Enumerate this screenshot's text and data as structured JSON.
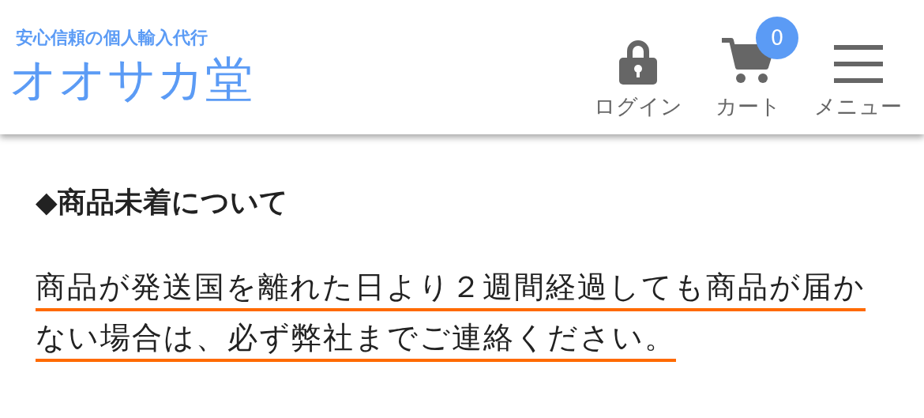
{
  "header": {
    "tagline": "安心信頼の個人輸入代行",
    "logo": "オオサカ堂",
    "nav": [
      {
        "kind": "lock",
        "label": "ログイン"
      },
      {
        "kind": "cart",
        "label": "カート",
        "badge": "0"
      },
      {
        "kind": "menu",
        "label": "メニュー"
      }
    ]
  },
  "section": {
    "heading": "◆商品未着について",
    "body": "商品が発送国を離れた日より２週間経過しても商品が届かない場合は、必ず弊社までご連絡ください。"
  }
}
